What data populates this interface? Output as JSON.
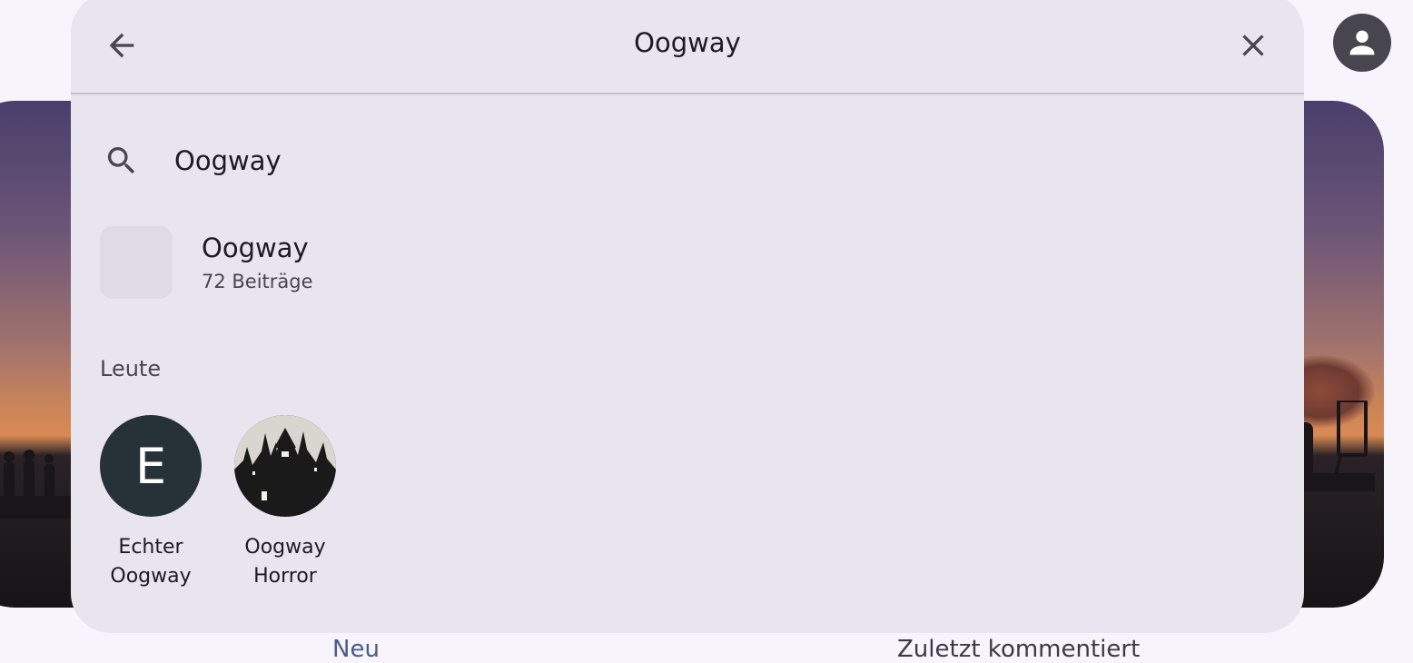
{
  "header": {
    "title": "Oogway",
    "back_icon": "arrow-left-icon",
    "close_icon": "close-icon"
  },
  "search": {
    "query": "Oogway",
    "icon": "search-icon"
  },
  "community": {
    "name": "Oogway",
    "post_count": "72 Beiträge"
  },
  "people_section": {
    "label": "Leute",
    "people": [
      {
        "initial": "E",
        "name_line1": "Echter",
        "name_line2": "Oogway",
        "avatar": "letter"
      },
      {
        "name_line1": "Oogway",
        "name_line2": "Horror",
        "avatar": "image"
      }
    ]
  },
  "bottom_tabs": {
    "new": "Neu",
    "recent": "Zuletzt kommentiert"
  },
  "colors": {
    "overlay_bg": "#e8e5ef",
    "letter_avatar_bg": "#263238",
    "active_tab": "#4a5a8a"
  }
}
